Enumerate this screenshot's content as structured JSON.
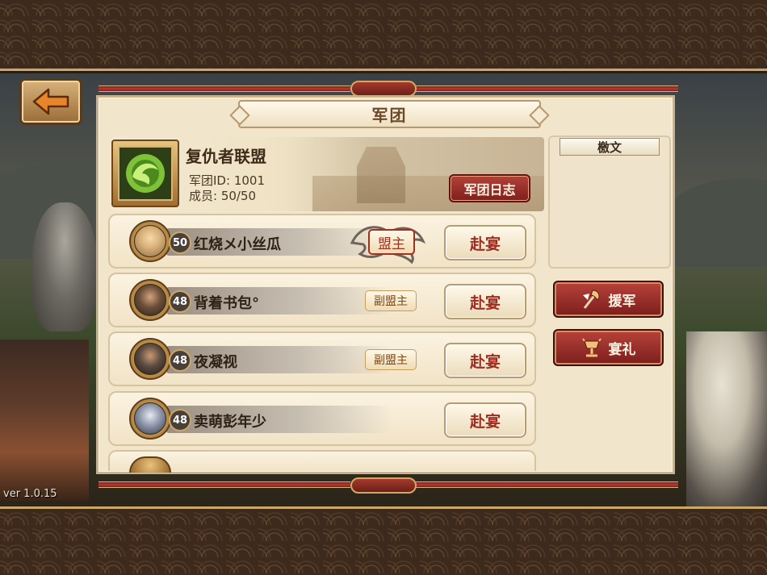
{
  "version": "ver 1.0.15",
  "title": "军团",
  "alliance": {
    "name": "复仇者联盟",
    "id_label": "军团ID:",
    "id_value": "1001",
    "members_label": "成员:",
    "members_value": "50/50",
    "log_button": "军团日志"
  },
  "notice": {
    "title": "檄文"
  },
  "side_buttons": {
    "aid": "援军",
    "gift": "宴礼"
  },
  "members": [
    {
      "level": "50",
      "name": "红烧メ小丝瓜",
      "role": "盟主",
      "action": "赴宴",
      "avatar_color": "#d9b27c"
    },
    {
      "level": "48",
      "name": "背着书包°",
      "role": "副盟主",
      "action": "赴宴",
      "avatar_color": "#6b4f3a"
    },
    {
      "level": "48",
      "name": "夜凝视",
      "role": "副盟主",
      "action": "赴宴",
      "avatar_color": "#5c4b40"
    },
    {
      "level": "48",
      "name": "卖萌彭年少",
      "role": "",
      "action": "赴宴",
      "avatar_color": "#8c96a8"
    }
  ],
  "colors": {
    "accent_red": "#a02c20",
    "parchment": "#f1e6cc",
    "gold": "#d7b27a"
  },
  "icons": {
    "back": "arrow-left-icon",
    "crest": "jade-dragon-icon",
    "aid": "axe-flag-icon",
    "gift": "wine-vessel-icon"
  }
}
